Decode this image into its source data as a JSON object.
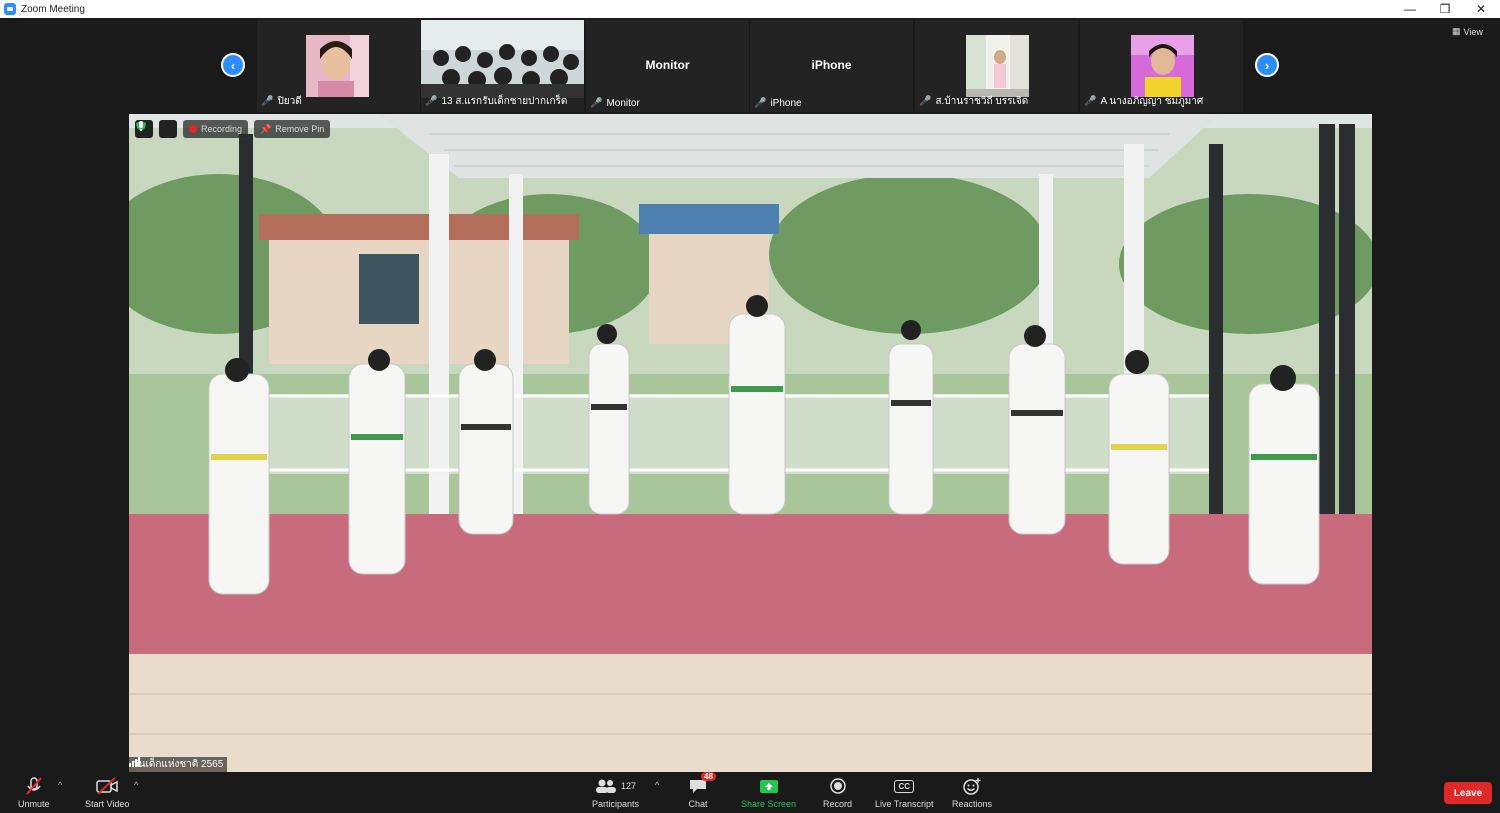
{
  "window": {
    "title": "Zoom Meeting"
  },
  "window_controls": [
    "—",
    "❐",
    "✕"
  ],
  "view_button": {
    "label": "View"
  },
  "strip": {
    "prev_arrow": "‹",
    "next_arrow": "›",
    "participants": [
      {
        "name": "ปิยวดี",
        "type": "photo",
        "muted": true
      },
      {
        "name": "13 ส.แรกรับเด็กชายปากเกร็ด",
        "type": "photo",
        "muted": true
      },
      {
        "name": "Monitor",
        "type": "name",
        "muted": true
      },
      {
        "name": "iPhone",
        "center_label": "iPhone",
        "type": "name",
        "muted": true
      },
      {
        "name": "ส.บ้านราชวิถี บรรเจิด",
        "type": "photo",
        "muted": true
      },
      {
        "name": "A นางอภิญญา ชมภูมาศ",
        "type": "photo",
        "muted": true
      }
    ],
    "monitor_center_label": "Monitor"
  },
  "main_video": {
    "recording_label": "Recording",
    "remove_pin_label": "Remove Pin",
    "speaker_label": "วันเด็กแห่งชาติ 2565"
  },
  "toolbar": {
    "unmute": "Unmute",
    "start_video": "Start Video",
    "participants": "Participants",
    "participants_count": "127",
    "chat": "Chat",
    "chat_badge": "48",
    "share_screen": "Share Screen",
    "record": "Record",
    "live_transcript": "Live Transcript",
    "reactions": "Reactions",
    "leave": "Leave",
    "cc": "CC"
  },
  "colors": {
    "accent": "#2d8cff",
    "share": "#23c552",
    "danger": "#e02828"
  }
}
